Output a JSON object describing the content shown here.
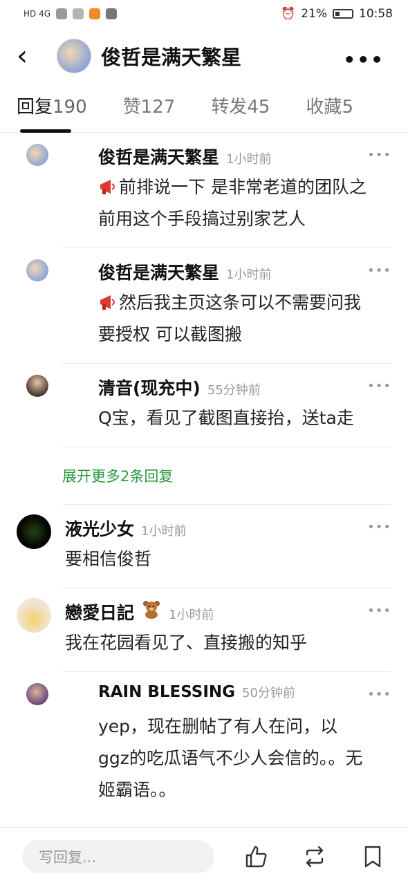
{
  "status_bar": {
    "left_network": "HD 4G",
    "battery": "21%",
    "time": "10:58"
  },
  "header": {
    "back_icon": "chevron-left-icon",
    "title": "俊哲是满天繁星",
    "more_icon": "more-dots-icon"
  },
  "tabs": [
    {
      "label": "回复",
      "count": "190"
    },
    {
      "label": "赞",
      "count": "127"
    },
    {
      "label": "转发",
      "count": "45"
    },
    {
      "label": "收藏",
      "count": "5"
    }
  ],
  "sub_replies": [
    {
      "name": "俊哲是满天繁星",
      "time": "1小时前",
      "text": "前排说一下 是非常老道的团队之前用这个手段搞过别家艺人"
    },
    {
      "name": "俊哲是满天繁星",
      "time": "1小时前",
      "text": "然后我主页这条可以不需要问我要授权 可以截图搬"
    },
    {
      "name": "清音(现充中)",
      "time": "55分钟前",
      "text": "Q宝，看见了截图直接抬，送ta走"
    }
  ],
  "expand_label": "展开更多2条回复",
  "main_replies": [
    {
      "name": "液光少女",
      "time": "1小时前",
      "text": "要相信俊哲"
    },
    {
      "name": "戀愛日記",
      "time": "1小时前",
      "text": "我在花园看见了、直接搬的知乎"
    }
  ],
  "nested_reply": {
    "name": "RAIN BLESSING",
    "time": "50分钟前",
    "text": "yep，现在删帖了有人在问，以ggz的吃瓜语气不少人会信的。。无姬霸语。。"
  },
  "bottom_bar": {
    "input_placeholder": "写回复...",
    "icons": [
      "thumbs-up-icon",
      "repost-icon",
      "bookmark-icon"
    ]
  },
  "colors": {
    "accent_green": "#2a9a3d",
    "megaphone": "#e0392b"
  }
}
